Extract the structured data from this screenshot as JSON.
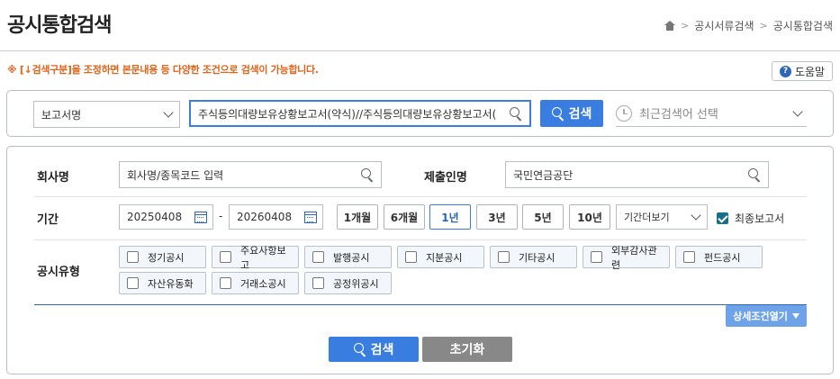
{
  "page": {
    "title": "공시통합검색",
    "breadcrumb": [
      "공시서류검색",
      "공시통합검색"
    ],
    "notice": "※ [↓검색구분]을 조정하면 본문내용 등 다양한 조건으로 검색이 가능합니다.",
    "help_label": "도움말"
  },
  "search": {
    "scope_value": "보고서명",
    "keyword_value": "주식등의대량보유상황보고서(약식)//주식등의대량보유상황보고서(",
    "search_label": "검색",
    "recent_placeholder": "최근검색어 선택"
  },
  "filters": {
    "company_label": "회사명",
    "company_placeholder": "회사명/종목코드 입력",
    "submitter_label": "제출인명",
    "submitter_value": "국민연금공단",
    "period_label": "기간",
    "date_from": "20250408",
    "date_sep": "-",
    "date_to": "20260408",
    "period_buttons": [
      "1개월",
      "6개월",
      "1년",
      "3년",
      "5년",
      "10년"
    ],
    "period_active": "1년",
    "period_more": "기간더보기",
    "final_report_label": "최종보고서",
    "final_report_checked": true,
    "type_label": "공시유형",
    "types": [
      "정기공시",
      "주요사항보고",
      "발행공시",
      "지분공시",
      "기타공시",
      "외부감사관련",
      "펀드공시",
      "자산유동화",
      "거래소공시",
      "공정위공시"
    ],
    "detail_toggle": "상세조건열기",
    "search_label": "검색",
    "reset_label": "초기화"
  },
  "colors": {
    "accent": "#3a7de0",
    "notice": "#e0631a",
    "checkbox_on": "#17708a"
  }
}
